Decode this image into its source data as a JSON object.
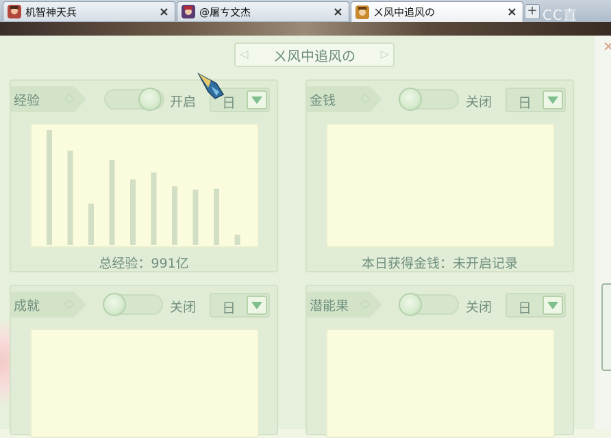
{
  "tabs": [
    {
      "title": "机智神天兵",
      "close": "×",
      "active": false
    },
    {
      "title": "@屠ㄘ文杰",
      "close": "×",
      "active": false
    },
    {
      "title": "ㄨ风中追风の",
      "close": "×",
      "active": true
    }
  ],
  "new_tab": "+",
  "watermark": "CC直",
  "panel": {
    "title": "ㄨ风中追风の",
    "cards": [
      {
        "label": "经验",
        "toggle_on": true,
        "toggle_state": "开启",
        "period": "日",
        "footer": "总经验：991亿",
        "chart_bars": [
          100,
          82,
          36,
          74,
          57,
          63,
          51,
          48,
          49,
          9
        ]
      },
      {
        "label": "金钱",
        "toggle_on": false,
        "toggle_state": "关闭",
        "period": "日",
        "footer": "本日获得金钱：未开启记录"
      },
      {
        "label": "成就",
        "toggle_on": false,
        "toggle_state": "关闭",
        "period": "日",
        "footer": ""
      },
      {
        "label": "潜能果",
        "toggle_on": false,
        "toggle_state": "关闭",
        "period": "日",
        "footer": ""
      }
    ]
  },
  "colors": {
    "panel_bg": "#e7f0dc",
    "chart_bg": "#fbfbde",
    "bar": "#d2dfc4",
    "text": "#6e8f7e",
    "arrow": "#7fbf8e"
  }
}
